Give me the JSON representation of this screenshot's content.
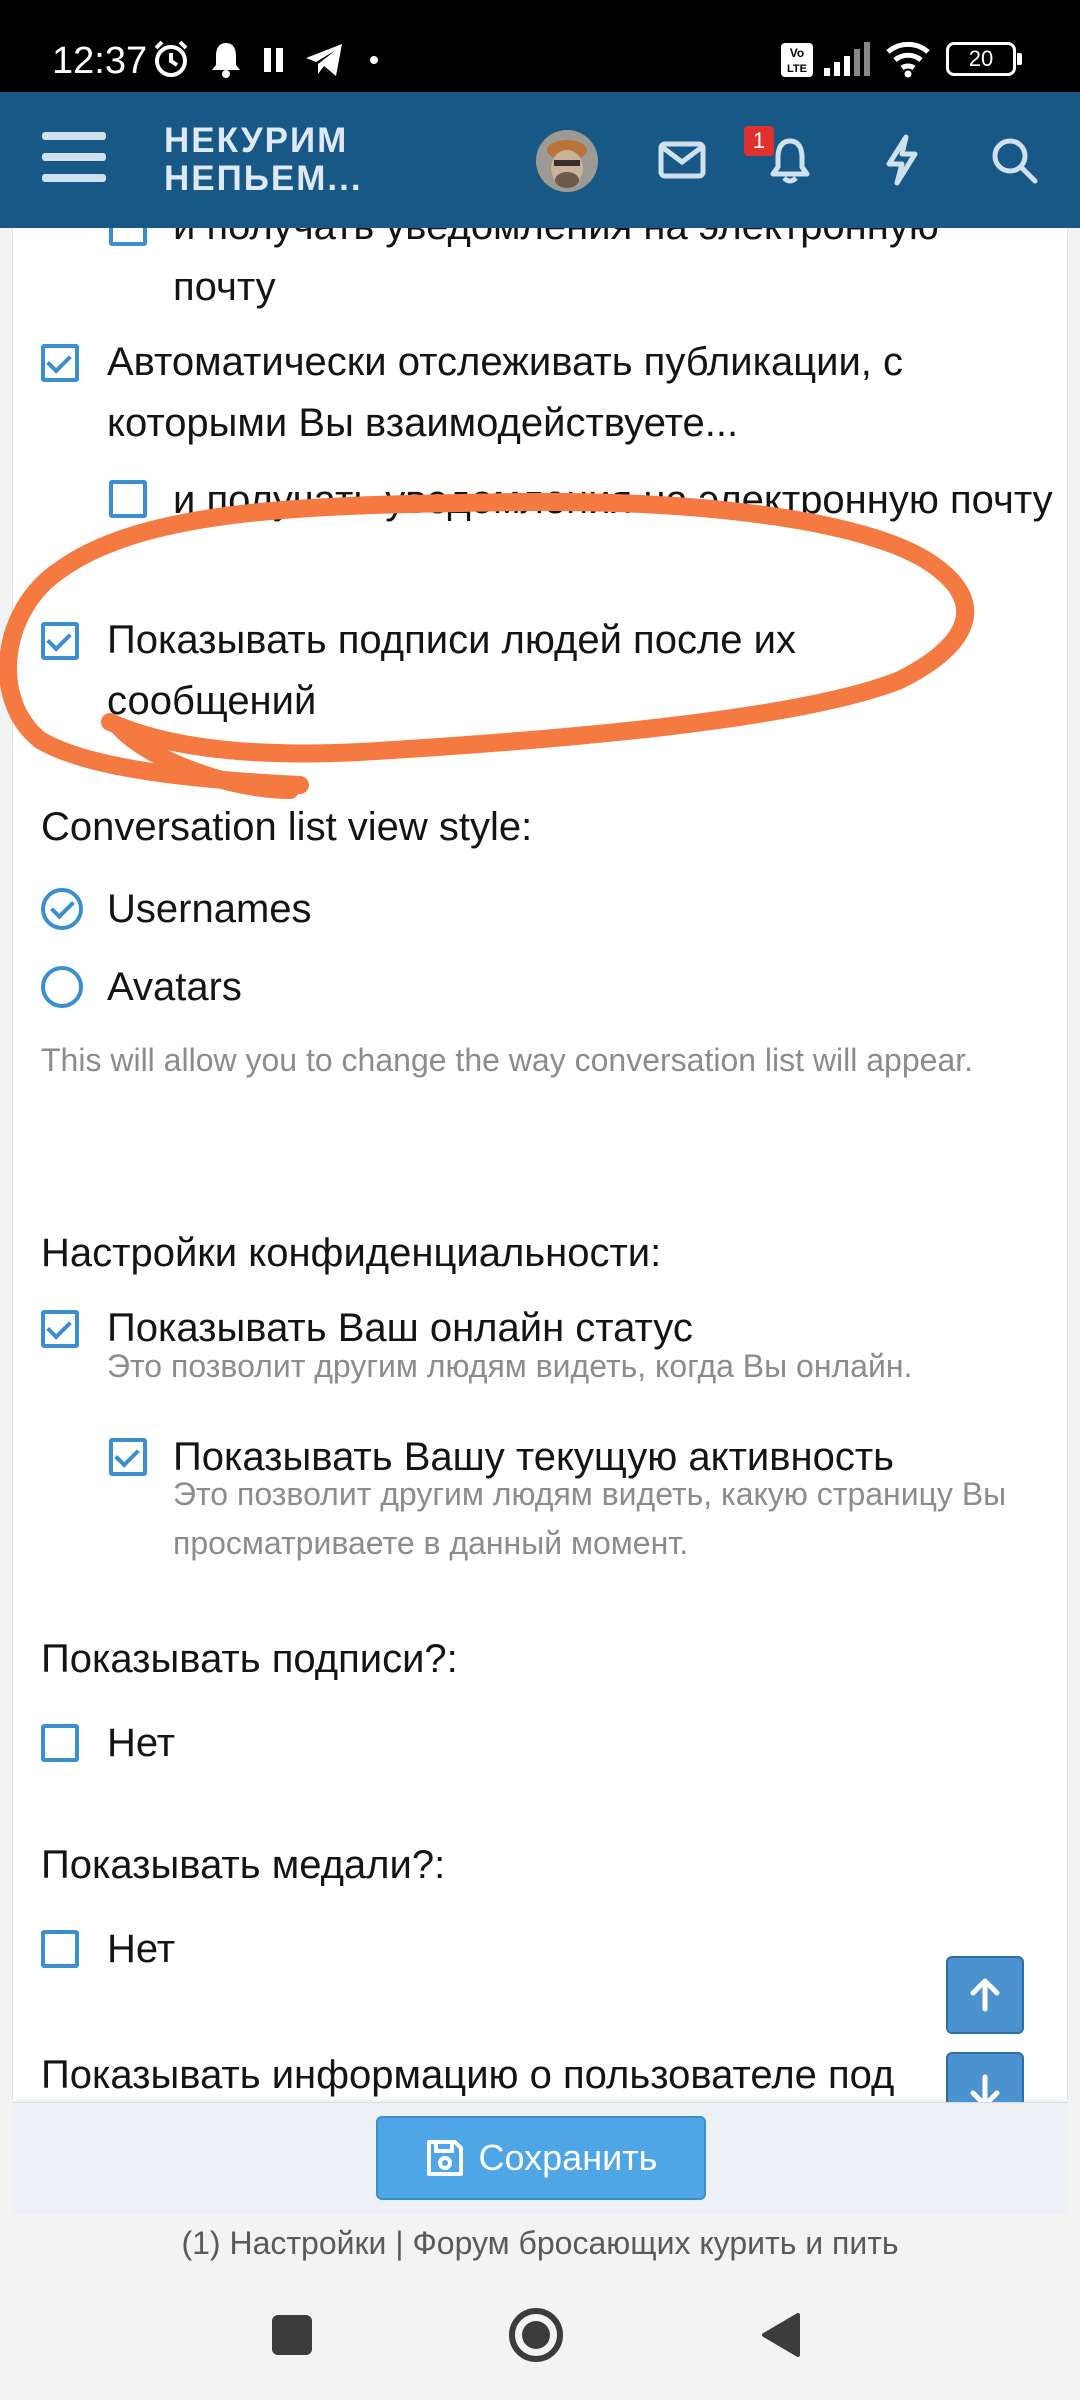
{
  "status_bar": {
    "time": "12:37",
    "network_label": "Vo LTE",
    "battery": "20"
  },
  "header": {
    "logo_line1": "НЕКУРИМ",
    "logo_line2": "НЕПЬЕМ...",
    "notification_count": "1"
  },
  "preferences": {
    "partial_email_text": "и получать уведомления на электронную",
    "partial_email_text_2": "почту",
    "auto_watch_label": "Автоматически отслеживать публикации, с которыми Вы взаимодействуете...",
    "auto_watch_email_label": "и получать уведомления на электронную почту",
    "show_signatures_label": "Показывать подписи людей после их сообщений"
  },
  "conversation_style": {
    "heading": "Conversation list view style:",
    "options": [
      "Usernames",
      "Avatars"
    ],
    "selected": "Usernames",
    "hint": "This will allow you to change the way conversation list will appear."
  },
  "privacy": {
    "heading": "Настройки конфиденциальности:",
    "online_status_label": "Показывать Ваш онлайн статус",
    "online_status_hint": "Это позволит другим людям видеть, когда Вы онлайн.",
    "activity_label": "Показывать Вашу текущую активность",
    "activity_hint": "Это позволит другим людям видеть, какую страницу Вы просматриваете в данный момент."
  },
  "signatures_option": {
    "heading": "Показывать подписи?:",
    "value_label": "Нет"
  },
  "medals_option": {
    "heading": "Показывать медали?:",
    "value_label": "Нет"
  },
  "user_info_heading": "Показывать информацию о пользователе под",
  "footer": {
    "save_label": "Сохранить",
    "page_title": "(1) Настройки | Форум бросающих курить и пить"
  },
  "colors": {
    "header_bg": "#185886",
    "accent": "#3a8fcf",
    "save_button": "#4ea6e6",
    "annotation": "#f47a42"
  }
}
